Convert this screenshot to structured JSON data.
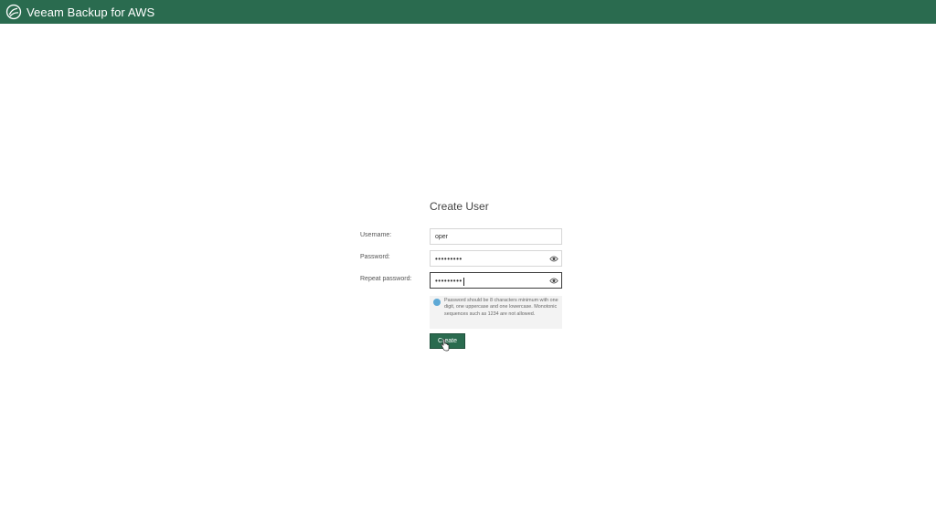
{
  "header": {
    "title": "Veeam Backup for AWS",
    "logo_icon": "veeam-logo-icon",
    "background_color": "#2a6b4f"
  },
  "form": {
    "title": "Create User",
    "username": {
      "label": "Username:",
      "value": "oper"
    },
    "password": {
      "label": "Password:",
      "value": "•••••••••",
      "toggle_icon": "eye-icon"
    },
    "repeat_password": {
      "label": "Repeat password:",
      "value": "•••••••••",
      "toggle_icon": "eye-icon"
    },
    "hint": {
      "icon": "info-icon",
      "text": "Password should be 8 characters minimum with one digit, one uppercase and one lowercase. Monotonic sequences such as 1234 are not allowed."
    },
    "create_label": "Create",
    "accent_color": "#2a6b4f"
  }
}
